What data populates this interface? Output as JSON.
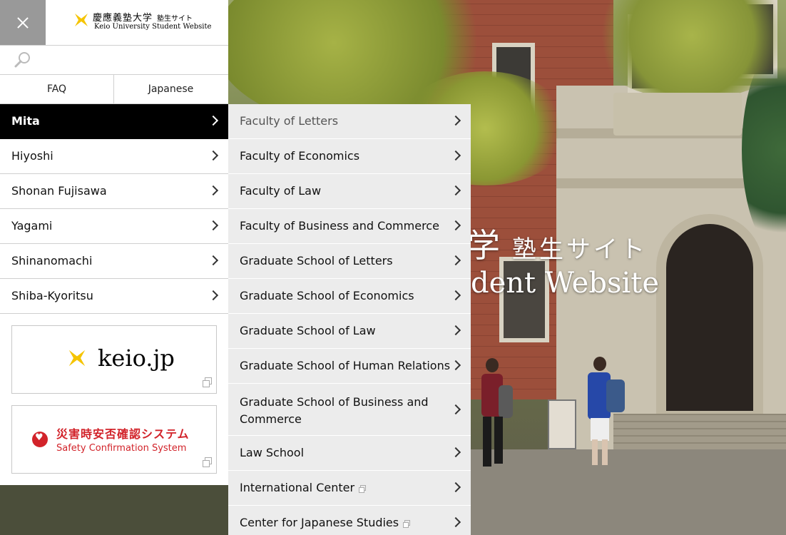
{
  "header": {
    "logo_title_jp": "慶應義塾大学",
    "logo_title_small": "塾生サイト",
    "logo_subtitle": "Keio University Student Website"
  },
  "search": {
    "placeholder": ""
  },
  "lang_links": {
    "faq": "FAQ",
    "japanese": "Japanese"
  },
  "campuses": [
    {
      "label": "Mita",
      "active": true
    },
    {
      "label": "Hiyoshi"
    },
    {
      "label": "Shonan Fujisawa"
    },
    {
      "label": "Yagami"
    },
    {
      "label": "Shinanomachi"
    },
    {
      "label": "Shiba-Kyoritsu"
    }
  ],
  "promos": {
    "keiojp": "keio.jp",
    "safety_jp": "災害時安否確認システム",
    "safety_en": "Safety Confirmation System"
  },
  "submenu": [
    {
      "label": "Faculty of Letters"
    },
    {
      "label": "Faculty of Economics"
    },
    {
      "label": "Faculty of Law"
    },
    {
      "label": "Faculty of Business and Commerce"
    },
    {
      "label": "Graduate School of Letters"
    },
    {
      "label": "Graduate School of Economics"
    },
    {
      "label": "Graduate School of Law"
    },
    {
      "label": "Graduate School of Human Relations"
    },
    {
      "label": "Graduate School of Business and Commerce"
    },
    {
      "label": "Law School"
    },
    {
      "label": "International Center",
      "external": true
    },
    {
      "label": "Center for Japanese Studies",
      "external": true
    }
  ],
  "hero": {
    "title_fragment": "学",
    "title_small": "塾生サイト",
    "subtitle_fragment": "dent Website"
  },
  "colors": {
    "accent_yellow": "#f5c400",
    "safety_red": "#d2232a",
    "active_bg": "#000000"
  }
}
